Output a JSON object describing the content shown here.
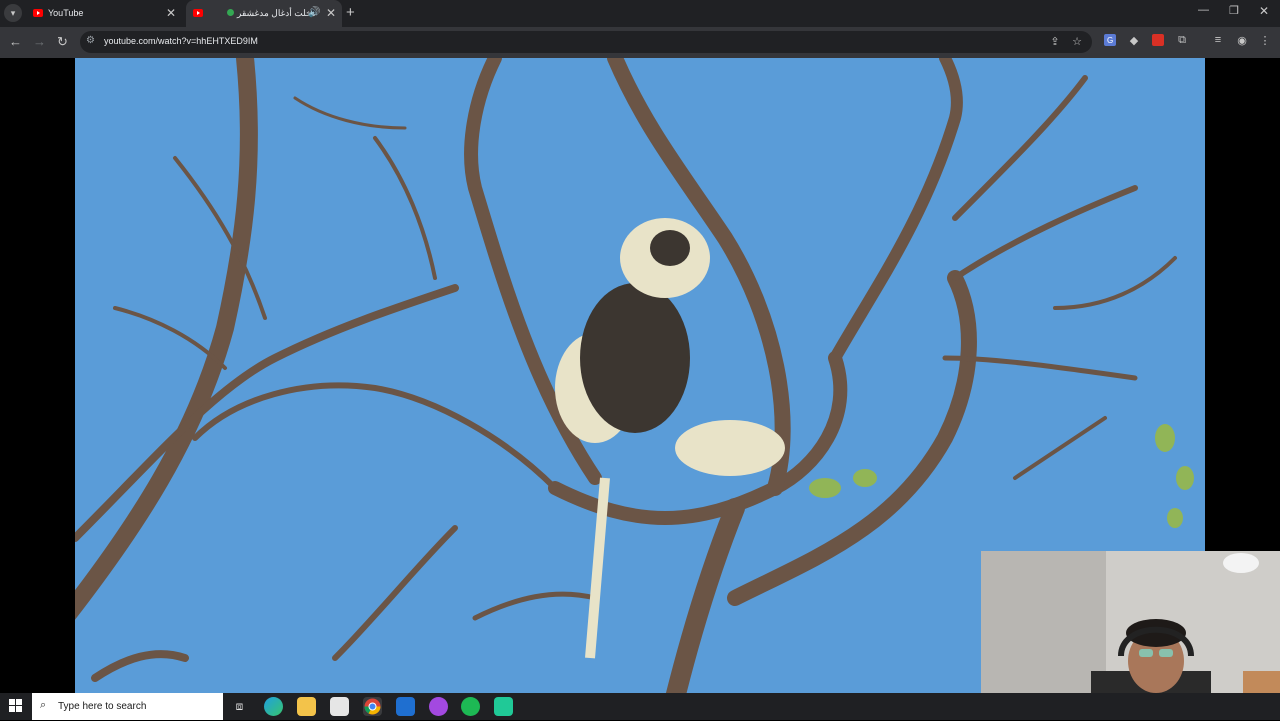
{
  "tabs": [
    {
      "title": "YouTube",
      "active": false
    },
    {
      "title": "دخلت أدغال مدغشقر",
      "active": true
    }
  ],
  "address_bar": {
    "url": "youtube.com/watch?v=hhEHTXED9IM"
  },
  "taskbar": {
    "search_placeholder": "Type here to search"
  },
  "colors": {
    "tab_strip": "#202124",
    "toolbar": "#35363a",
    "sky": "#5a9cd8",
    "branch": "#6b5546",
    "lemur_fur": "#e8e3c8",
    "lemur_dark": "#3c3630",
    "youtube_red": "#ff0000"
  },
  "icons": [
    "tab-list-icon",
    "youtube-favicon",
    "recording-icon",
    "audio-icon",
    "close-icon",
    "new-tab-icon",
    "minimize-icon",
    "restore-icon",
    "back-icon",
    "forward-icon",
    "reload-icon",
    "site-info-icon",
    "install-icon",
    "bookmark-star-icon",
    "translate-icon",
    "extension-icon",
    "puzzle-icon",
    "media-icon",
    "profile-icon",
    "menu-icon",
    "windows-start-icon",
    "search-icon",
    "task-view-icon",
    "edge-icon",
    "file-explorer-icon",
    "store-icon",
    "chrome-icon",
    "mail-icon",
    "messenger-icon",
    "spotify-icon",
    "app-icon"
  ]
}
